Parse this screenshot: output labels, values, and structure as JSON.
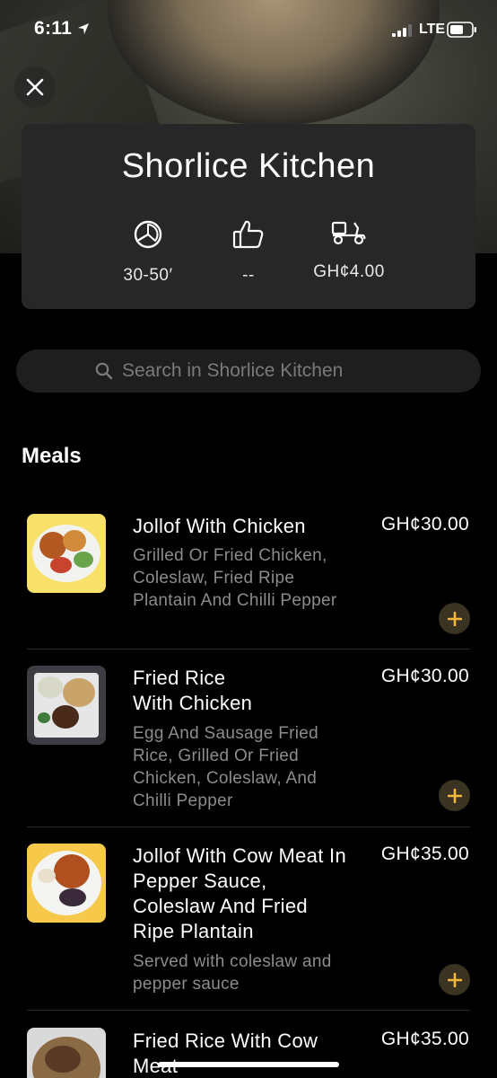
{
  "status_bar": {
    "time": "6:11",
    "network": "LTE"
  },
  "restaurant": {
    "name": "Shorlice Kitchen",
    "stats": [
      {
        "icon": "clock-icon",
        "value": "30-50′"
      },
      {
        "icon": "thumbs-up-icon",
        "value": "--"
      },
      {
        "icon": "delivery-scooter-icon",
        "value": "GH¢4.00"
      }
    ]
  },
  "search": {
    "placeholder": "Search in Shorlice Kitchen"
  },
  "section": {
    "title": "Meals"
  },
  "menu_items": [
    {
      "name": "Jollof With Chicken",
      "description": "Grilled Or Fried Chicken, Coleslaw, Fried Ripe Plantain And Chilli Pepper",
      "price": "GH¢30.00"
    },
    {
      "name": "Fried Rice\nWith Chicken",
      "description": "Egg And Sausage Fried Rice, Grilled Or Fried Chicken, Coleslaw, And Chilli Pepper",
      "price": "GH¢30.00"
    },
    {
      "name": "Jollof With Cow Meat In Pepper Sauce, Coleslaw And Fried Ripe Plantain",
      "description": "Served with coleslaw and pepper sauce",
      "price": "GH¢35.00"
    },
    {
      "name": "Fried Rice With Cow Meat",
      "description": "",
      "price": "GH¢35.00"
    }
  ],
  "colors": {
    "accent": "#f5b73b",
    "card_bg": "#272727",
    "muted_text": "#8c8c8c"
  }
}
